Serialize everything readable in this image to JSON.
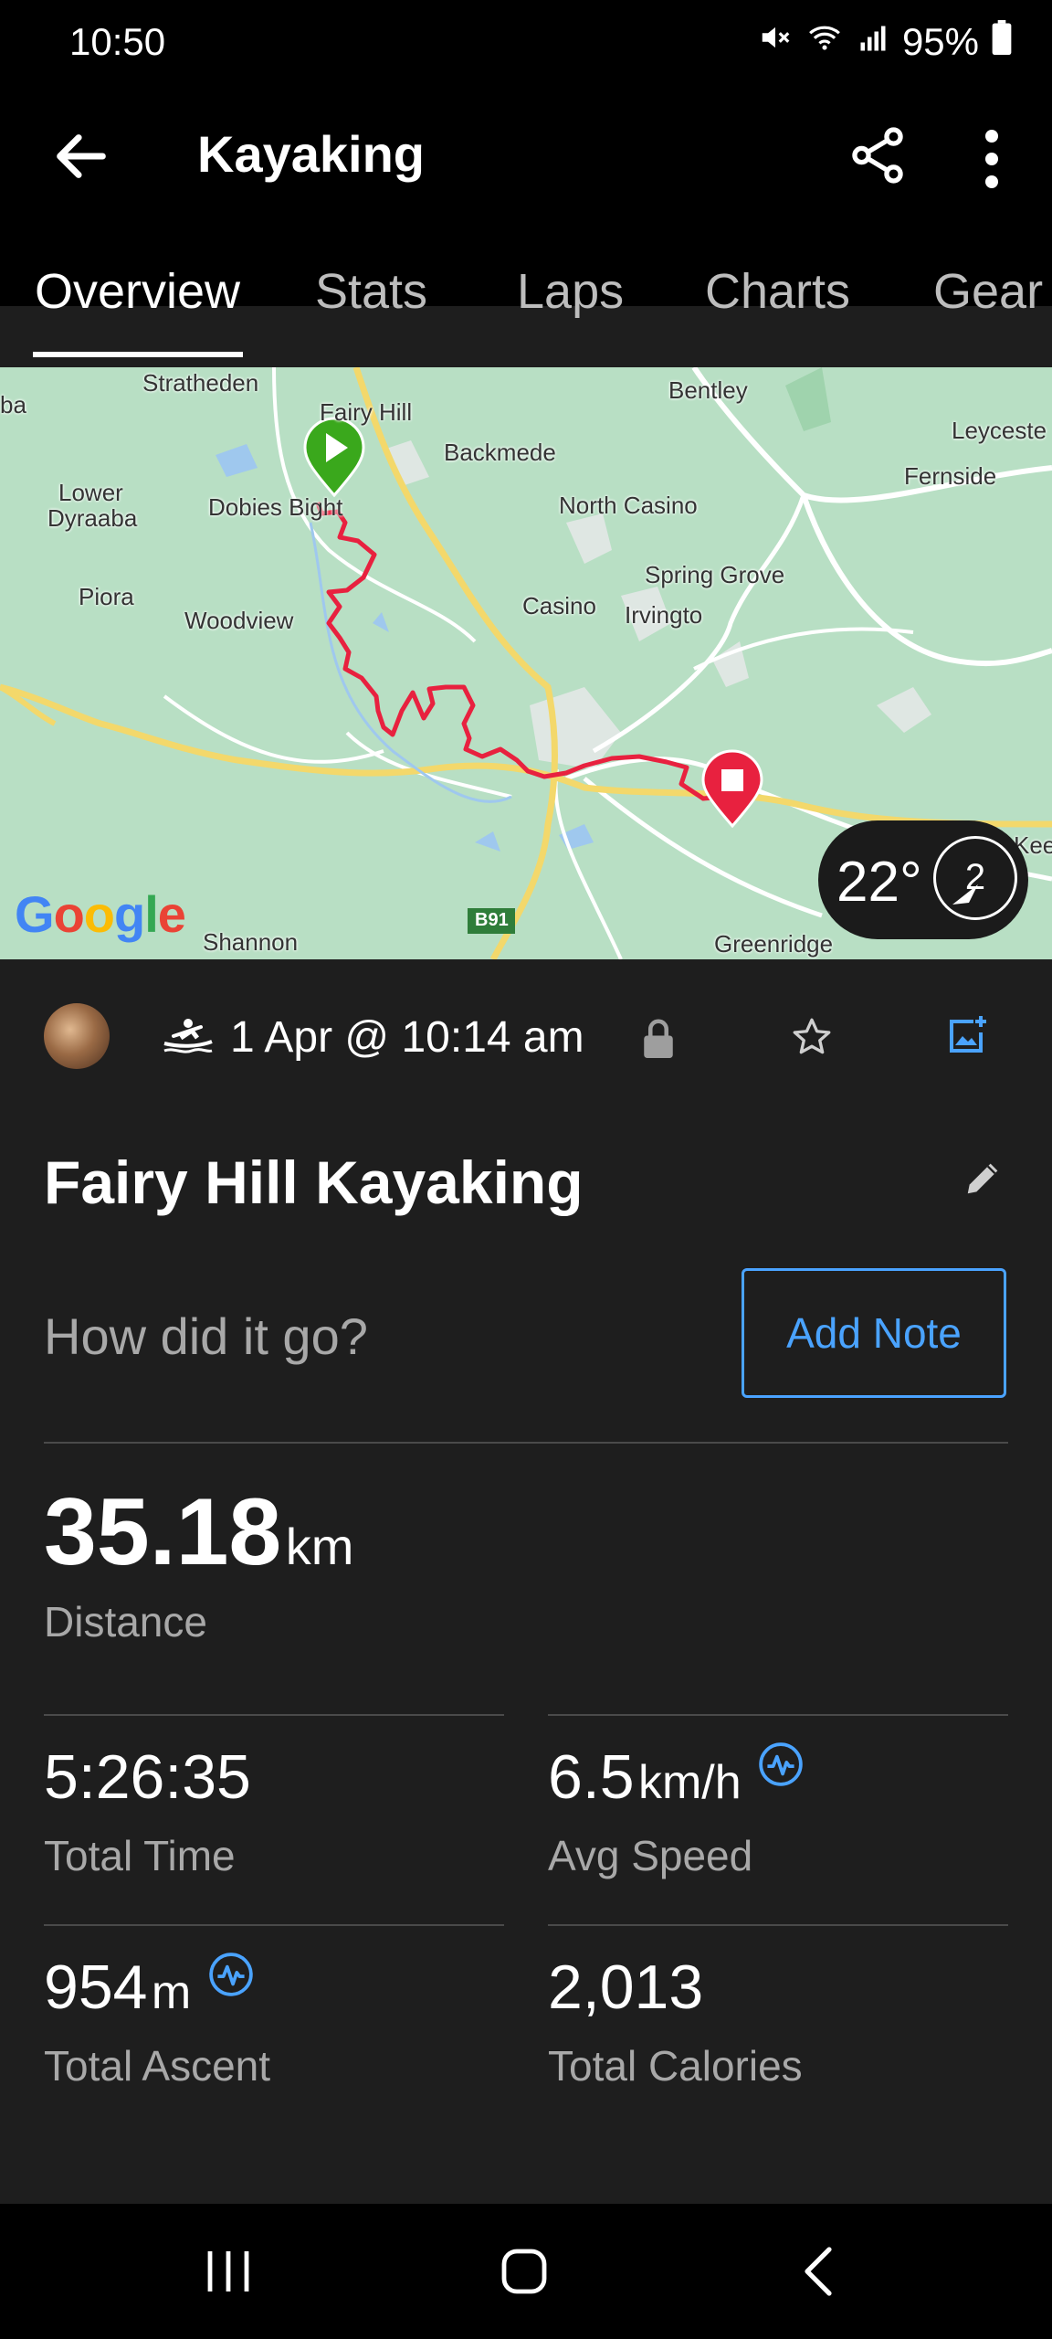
{
  "status_bar": {
    "time": "10:50",
    "battery": "95%"
  },
  "app_bar": {
    "title": "Kayaking"
  },
  "tabs": [
    {
      "label": "Overview"
    },
    {
      "label": "Stats"
    },
    {
      "label": "Laps"
    },
    {
      "label": "Charts"
    },
    {
      "label": "Gear"
    }
  ],
  "map": {
    "labels": {
      "stratheden": "Stratheden",
      "fairy_hill": "Fairy Hill",
      "bentley": "Bentley",
      "leycester": "Leyceste",
      "ba": "ba",
      "backmede": "Backmede",
      "fernside": "Fernside",
      "lower": "Lower",
      "dyraaba": "Dyraaba",
      "dobies_bight": "Dobies Bight",
      "north_casino": "North Casino",
      "spring_grove": "Spring Grove",
      "piora": "Piora",
      "woodview": "Woodview",
      "casino": "Casino",
      "irvington": "Irvingto",
      "kee": "Kee",
      "shannon": "Shannon",
      "b91": "B91",
      "greenridge": "Greenridge"
    },
    "logo": "Google",
    "temperature": "22°",
    "wind": "2"
  },
  "activity": {
    "date": "1 Apr @ 10:14 am",
    "name": "Fairy Hill Kayaking",
    "note_prompt": "How did it go?",
    "add_note_label": "Add Note"
  },
  "stats": {
    "distance": {
      "value": "35.18",
      "unit": "km",
      "label": "Distance"
    },
    "total_time": {
      "value": "5:26:35",
      "label": "Total Time"
    },
    "avg_speed": {
      "value": "6.5",
      "unit": "km/h",
      "label": "Avg Speed"
    },
    "total_ascent": {
      "value": "954",
      "unit": "m",
      "label": "Total Ascent"
    },
    "total_calories": {
      "value": "2,013",
      "label": "Total Calories"
    }
  },
  "icons": {
    "accent": "#4aa3ff",
    "route": "#e8213f",
    "start_pin": "#3aa81c",
    "end_pin": "#e8213f"
  }
}
